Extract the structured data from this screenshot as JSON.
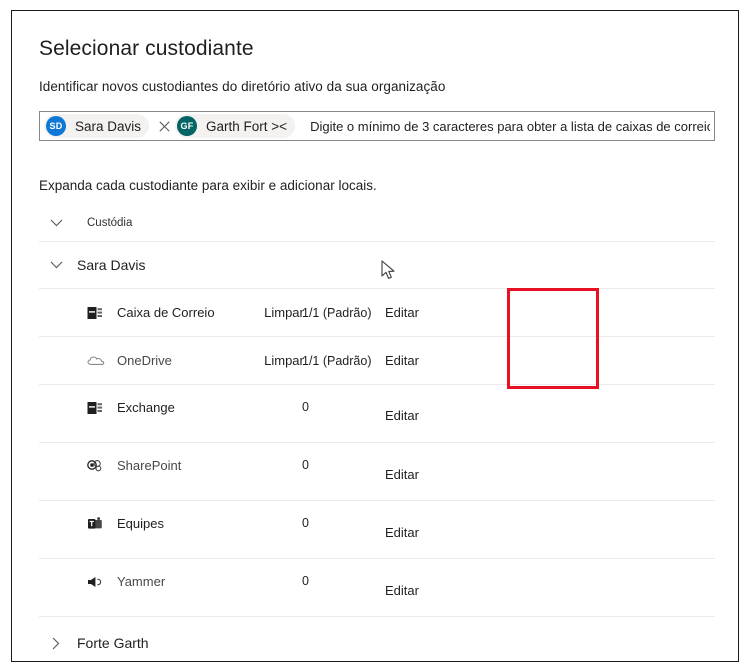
{
  "dialog": {
    "title": "Selecionar custodiante",
    "subtitle": "Identificar novos custodiantes do diretório ativo da sua organização",
    "instruction": "Expanda cada custodiante para exibir e adicionar locais."
  },
  "picker": {
    "placeholder": "Digite o mínimo de 3 caracteres para obter a lista de caixas de correio.",
    "value": "",
    "pills": [
      {
        "initials": "SD",
        "name": "Sara Davis",
        "color": "#0f78d4",
        "has_close": true
      },
      {
        "initials": "GF",
        "name": "Garth Fort ><",
        "color": "#026465",
        "has_close": false
      }
    ]
  },
  "list": {
    "column_header": "Custódia",
    "groups": [
      {
        "name": "Sara Davis",
        "expanded": true,
        "chevron": "chevron-down-icon",
        "locations": [
          {
            "icon": "mailbox-icon",
            "label": "Caixa de Correio",
            "count": "1/1 (Padrão)",
            "clear_label": "Limpar",
            "edit_label": "Editar",
            "has_clear": true
          },
          {
            "icon": "onedrive-icon",
            "label": "OneDrive",
            "count": "1/1 (Padrão)",
            "clear_label": "Limpar",
            "edit_label": "Editar",
            "has_clear": true
          },
          {
            "icon": "exchange-icon",
            "label": "Exchange",
            "count": "0",
            "clear_label": "",
            "edit_label": "Editar",
            "has_clear": false
          },
          {
            "icon": "sharepoint-icon",
            "label": "SharePoint",
            "count": "0",
            "clear_label": "",
            "edit_label": "Editar",
            "has_clear": false
          },
          {
            "icon": "teams-icon",
            "label": "Equipes",
            "count": "0",
            "clear_label": "",
            "edit_label": "Editar",
            "has_clear": false
          },
          {
            "icon": "yammer-icon",
            "label": "Yammer",
            "count": "0",
            "clear_label": "",
            "edit_label": "Editar",
            "has_clear": false
          }
        ]
      },
      {
        "name": "Forte Garth",
        "expanded": false,
        "chevron": "chevron-right-icon",
        "locations": []
      }
    ]
  },
  "annotation": {
    "highlight_color": "#e81123"
  }
}
